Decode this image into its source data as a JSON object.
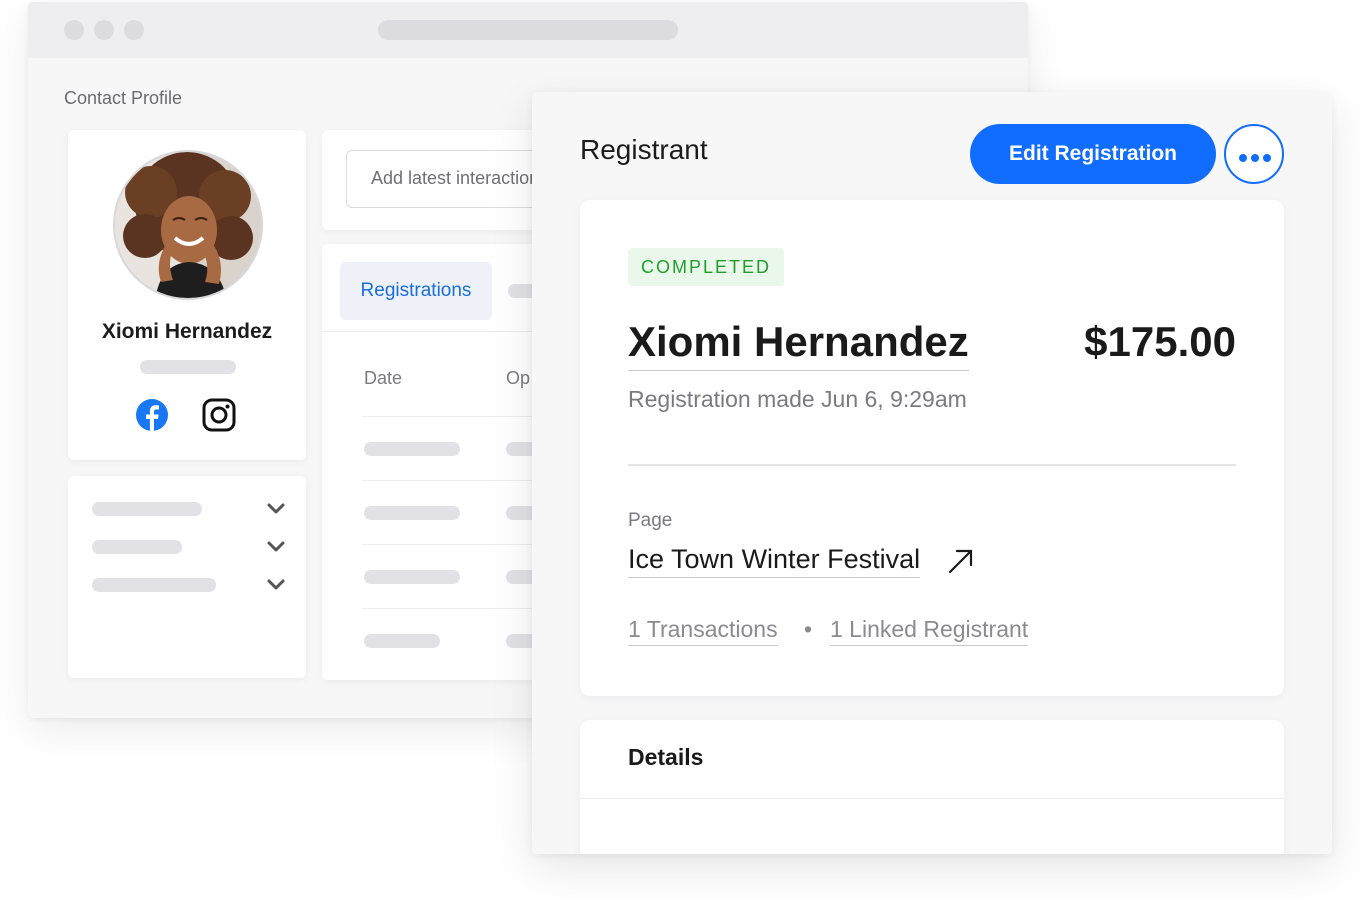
{
  "contact_profile": {
    "section_label": "Contact Profile",
    "profile": {
      "name": "Xiomi Hernandez",
      "social_icons": [
        "facebook-icon",
        "instagram-icon"
      ]
    },
    "interaction_input": {
      "placeholder": "Add latest interaction"
    },
    "tabs": [
      {
        "label": "Registrations",
        "active": true
      }
    ],
    "table": {
      "columns": [
        "Date",
        "Op"
      ]
    }
  },
  "registrant_panel": {
    "title": "Registrant",
    "edit_button_label": "Edit Registration",
    "more_icon": "more-horizontal-icon",
    "status": "COMPLETED",
    "registrant_name": "Xiomi Hernandez",
    "amount": "$175.00",
    "registration_date": "Registration made Jun 6, 9:29am",
    "page_label": "Page",
    "page_name": "Ice Town Winter Festival",
    "transactions_link": "1 Transactions",
    "separator": "•",
    "linked_registrant_link": "1 Linked Registrant",
    "details_title": "Details"
  },
  "colors": {
    "accent": "#116dff",
    "status_green": "#1f9e2c",
    "status_bg": "#e9f8ea",
    "tab_blue": "#1a6ed8"
  }
}
